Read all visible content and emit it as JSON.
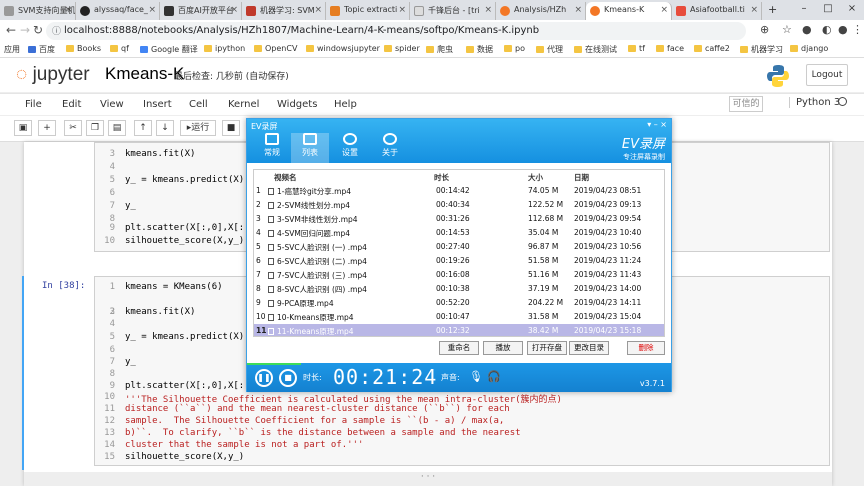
{
  "browser": {
    "tabs": [
      {
        "label": "SVM支持向量机"
      },
      {
        "label": "alyssaq/face_"
      },
      {
        "label": "百度AI开放平台"
      },
      {
        "label": "机器学习: SVM"
      },
      {
        "label": "Topic extracti"
      },
      {
        "label": "千锋后台 - [tri"
      },
      {
        "label": "Analysis/HZh"
      },
      {
        "label": "Kmeans-K"
      },
      {
        "label": "Asiafootball.ti"
      }
    ],
    "active_tab": "Kmeans-K",
    "url": "localhost:8888/notebooks/Analysis/HZh1807/Machine-Learn/4-K-means/softpo/Kmeans-K.ipynb",
    "bookmarks": [
      "应用",
      "百度",
      "Books",
      "qf",
      "Google 翻译",
      "ipython",
      "OpenCV",
      "windowsjupyter",
      "spider",
      "爬虫",
      "数据",
      "po",
      "代理",
      "在线测试",
      "tf",
      "face",
      "caffe2",
      "机器学习",
      "django"
    ]
  },
  "jupyter": {
    "logo_text": "jupyter",
    "notebook_name": "Kmeans-K",
    "checkpoint": "最后检查: 几秒前  (自动保存)",
    "logout": "Logout",
    "menu": [
      "File",
      "Edit",
      "View",
      "Insert",
      "Cell",
      "Kernel",
      "Widgets",
      "Help"
    ],
    "trusted": "可信的",
    "kernel": "Python 3",
    "run_label": "运行"
  },
  "cells": {
    "cell1": {
      "lines": [
        {
          "n": "3",
          "code": "kmeans.fit(X)"
        },
        {
          "n": "4",
          "code": ""
        },
        {
          "n": "5",
          "code": "y_ = kmeans.predict(X)"
        },
        {
          "n": "6",
          "code": ""
        },
        {
          "n": "7",
          "code": "y_"
        },
        {
          "n": "8",
          "code": ""
        },
        {
          "n": "9",
          "code": "plt.scatter(X[:,0],X[:,1"
        },
        {
          "n": "10",
          "code": "silhouette_score(X,y_)"
        }
      ]
    },
    "cell2": {
      "prompt": "In  [38]:",
      "lines": [
        {
          "n": "1",
          "code": "kmeans = KMeans(6)"
        },
        {
          "n": "2",
          "code": ""
        },
        {
          "n": "3",
          "code": "kmeans.fit(X)"
        },
        {
          "n": "4",
          "code": ""
        },
        {
          "n": "5",
          "code": "y_ = kmeans.predict(X)"
        },
        {
          "n": "6",
          "code": ""
        },
        {
          "n": "7",
          "code": "y_"
        },
        {
          "n": "8",
          "code": ""
        },
        {
          "n": "9",
          "code": "plt.scatter(X[:,0],X[:,1"
        },
        {
          "n": "10",
          "code": "'''The Silhouette Coefficient is calculated using the mean intra-cluster(簇内的点)"
        },
        {
          "n": "11",
          "code": "distance (``a``) and the mean nearest-cluster distance (``b``) for each"
        },
        {
          "n": "12",
          "code": "sample.  The Silhouette Coefficient for a sample is ``(b - a) / max(a,"
        },
        {
          "n": "13",
          "code": "b)``.  To clarify, ``b`` is the distance between a sample and the nearest"
        },
        {
          "n": "14",
          "code": "cluster that the sample is not a part of.'''"
        },
        {
          "n": "15",
          "code": "silhouette_score(X,y_)"
        }
      ]
    }
  },
  "ev": {
    "title": "EV录屏",
    "tabs": [
      "常规",
      "列表",
      "设置",
      "关于"
    ],
    "brand": "EV录屏",
    "brand_sub": "专注屏幕录制",
    "headers": {
      "name": "视频名",
      "duration": "时长",
      "size": "大小",
      "date": "日期"
    },
    "rows": [
      {
        "idx": "1",
        "name": "1-癌慧玲git分享.mp4",
        "duration": "00:14:42",
        "size": "74.05 M",
        "date": "2019/04/23 08:51"
      },
      {
        "idx": "2",
        "name": "2-SVM线性划分.mp4",
        "duration": "00:40:34",
        "size": "122.52 M",
        "date": "2019/04/23 09:13"
      },
      {
        "idx": "3",
        "name": "3-SVM非线性划分.mp4",
        "duration": "00:31:26",
        "size": "112.68 M",
        "date": "2019/04/23 09:54"
      },
      {
        "idx": "4",
        "name": "4-SVM回归问题.mp4",
        "duration": "00:14:53",
        "size": "35.04 M",
        "date": "2019/04/23 10:40"
      },
      {
        "idx": "5",
        "name": "5-SVC人脸识别 (一) .mp4",
        "duration": "00:27:40",
        "size": "96.87 M",
        "date": "2019/04/23 10:56"
      },
      {
        "idx": "6",
        "name": "6-SVC人脸识别 (二) .mp4",
        "duration": "00:19:26",
        "size": "51.58 M",
        "date": "2019/04/23 11:24"
      },
      {
        "idx": "7",
        "name": "7-SVC人脸识别 (三) .mp4",
        "duration": "00:16:08",
        "size": "51.16 M",
        "date": "2019/04/23 11:43"
      },
      {
        "idx": "8",
        "name": "8-SVC人脸识别 (四) .mp4",
        "duration": "00:10:38",
        "size": "37.19 M",
        "date": "2019/04/23 14:00"
      },
      {
        "idx": "9",
        "name": "9-PCA原理.mp4",
        "duration": "00:52:20",
        "size": "204.22 M",
        "date": "2019/04/23 14:11"
      },
      {
        "idx": "10",
        "name": "10-Kmeans原理.mp4",
        "duration": "00:10:47",
        "size": "31.58 M",
        "date": "2019/04/23 15:04"
      },
      {
        "idx": "11",
        "name": "11-Kmeans原理.mp4",
        "duration": "00:12:32",
        "size": "38.42 M",
        "date": "2019/04/23 15:18"
      }
    ],
    "buttons": {
      "rename": "重命名",
      "play": "播放",
      "open": "打开存盘",
      "change": "更改目录",
      "delete": "删除"
    },
    "time_label": "时长:",
    "time": "00:21:24",
    "sound_label": "声音:",
    "version": "v3.7.1"
  }
}
